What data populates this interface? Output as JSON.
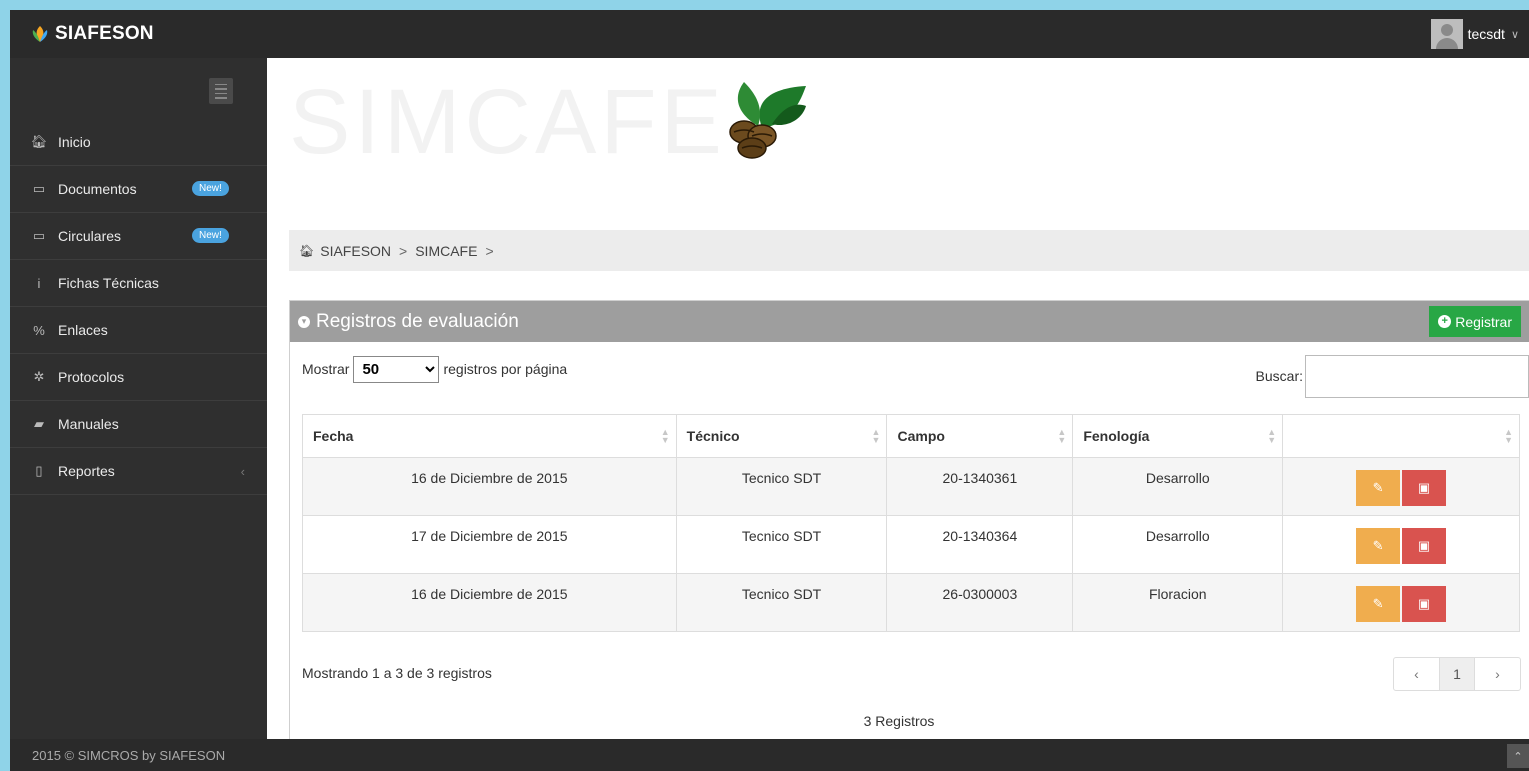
{
  "brand": {
    "name": "SIAFESON"
  },
  "user": {
    "name": "tecsdt",
    "caret": "∨"
  },
  "sidebar": {
    "items": [
      {
        "label": "Inicio",
        "icon": "home-icon",
        "glyph": "🏠︎",
        "badge": ""
      },
      {
        "label": "Documentos",
        "icon": "folder-icon",
        "glyph": "▭",
        "badge": "New!"
      },
      {
        "label": "Circulares",
        "icon": "folder-open-icon",
        "glyph": "▭",
        "badge": "New!"
      },
      {
        "label": "Fichas Técnicas",
        "icon": "info-icon",
        "glyph": "i",
        "badge": ""
      },
      {
        "label": "Enlaces",
        "icon": "link-icon",
        "glyph": "%",
        "badge": ""
      },
      {
        "label": "Protocolos",
        "icon": "gear-icon",
        "glyph": "✲",
        "badge": ""
      },
      {
        "label": "Manuales",
        "icon": "book-icon",
        "glyph": "▰",
        "badge": ""
      },
      {
        "label": "Reportes",
        "icon": "file-icon",
        "glyph": "▯",
        "badge": "",
        "chevron": "‹"
      }
    ]
  },
  "hero": {
    "title": "SIMCAFE"
  },
  "breadcrumb": {
    "items": [
      "SIAFESON",
      "SIMCAFE"
    ],
    "sep": ">"
  },
  "panel": {
    "title": "Registros de evaluación",
    "register_label": "Registrar",
    "show_prefix": "Mostrar",
    "page_size": "50",
    "show_suffix": "registros por página",
    "search_label": "Buscar:",
    "search_value": ""
  },
  "table": {
    "columns": [
      "Fecha",
      "Técnico",
      "Campo",
      "Fenología",
      ""
    ],
    "rows": [
      [
        "16 de Diciembre de 2015",
        "Tecnico SDT",
        "20-1340361",
        "Desarrollo"
      ],
      [
        "17 de Diciembre de 2015",
        "Tecnico SDT",
        "20-1340364",
        "Desarrollo"
      ],
      [
        "16 de Diciembre de 2015",
        "Tecnico SDT",
        "26-0300003",
        "Floracion"
      ]
    ]
  },
  "footer_info": {
    "showing": "Mostrando 1 a 3 de 3 registros",
    "total": "3 Registros",
    "pager": {
      "prev": "‹",
      "current": "1",
      "next": "›"
    }
  },
  "footer": {
    "text": "2015 © SIMCROS by SIAFESON"
  },
  "colors": {
    "accent_green": "#28a745",
    "edit": "#f0ad4e",
    "delete": "#d9534f",
    "badge": "#4aa3df"
  }
}
